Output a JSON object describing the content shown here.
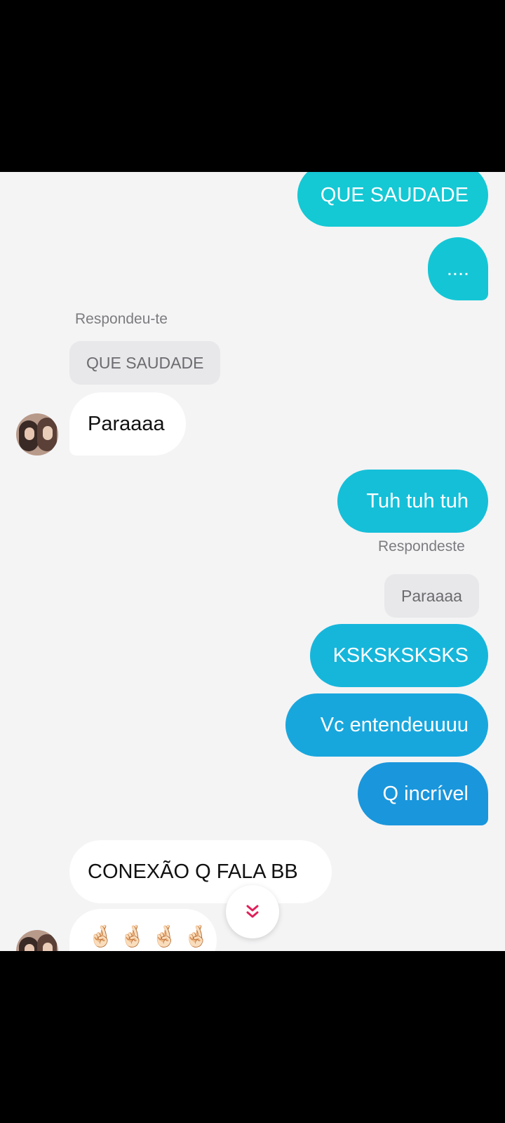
{
  "messages": {
    "m1": "QUE SAUDADE",
    "m2": "....",
    "reply1_label": "Respondeu-te",
    "reply1_quote": "QUE SAUDADE",
    "m3": "Paraaaa",
    "m4": "Tuh tuh tuh",
    "reply2_label": "Respondeste",
    "reply2_quote": "Paraaaa",
    "m5": "KSKSKSKSKS",
    "m6": "Vc entendeuuuu",
    "m7": "Q incrível",
    "m8": "CONEXÃO Q FALA BB",
    "m9": [
      "🤞🏻",
      "🤞🏻",
      "🤞🏻",
      "🤞🏻"
    ]
  },
  "colors": {
    "outgoing_top": "#14c8d4",
    "outgoing_mid": "#17b0dd",
    "outgoing_bottom": "#1a96dc",
    "incoming": "#ffffff",
    "background": "#f4f4f5",
    "scroll_chevron": "#e0205a"
  },
  "icons": {
    "scroll_down": "double-chevron-down-icon"
  }
}
